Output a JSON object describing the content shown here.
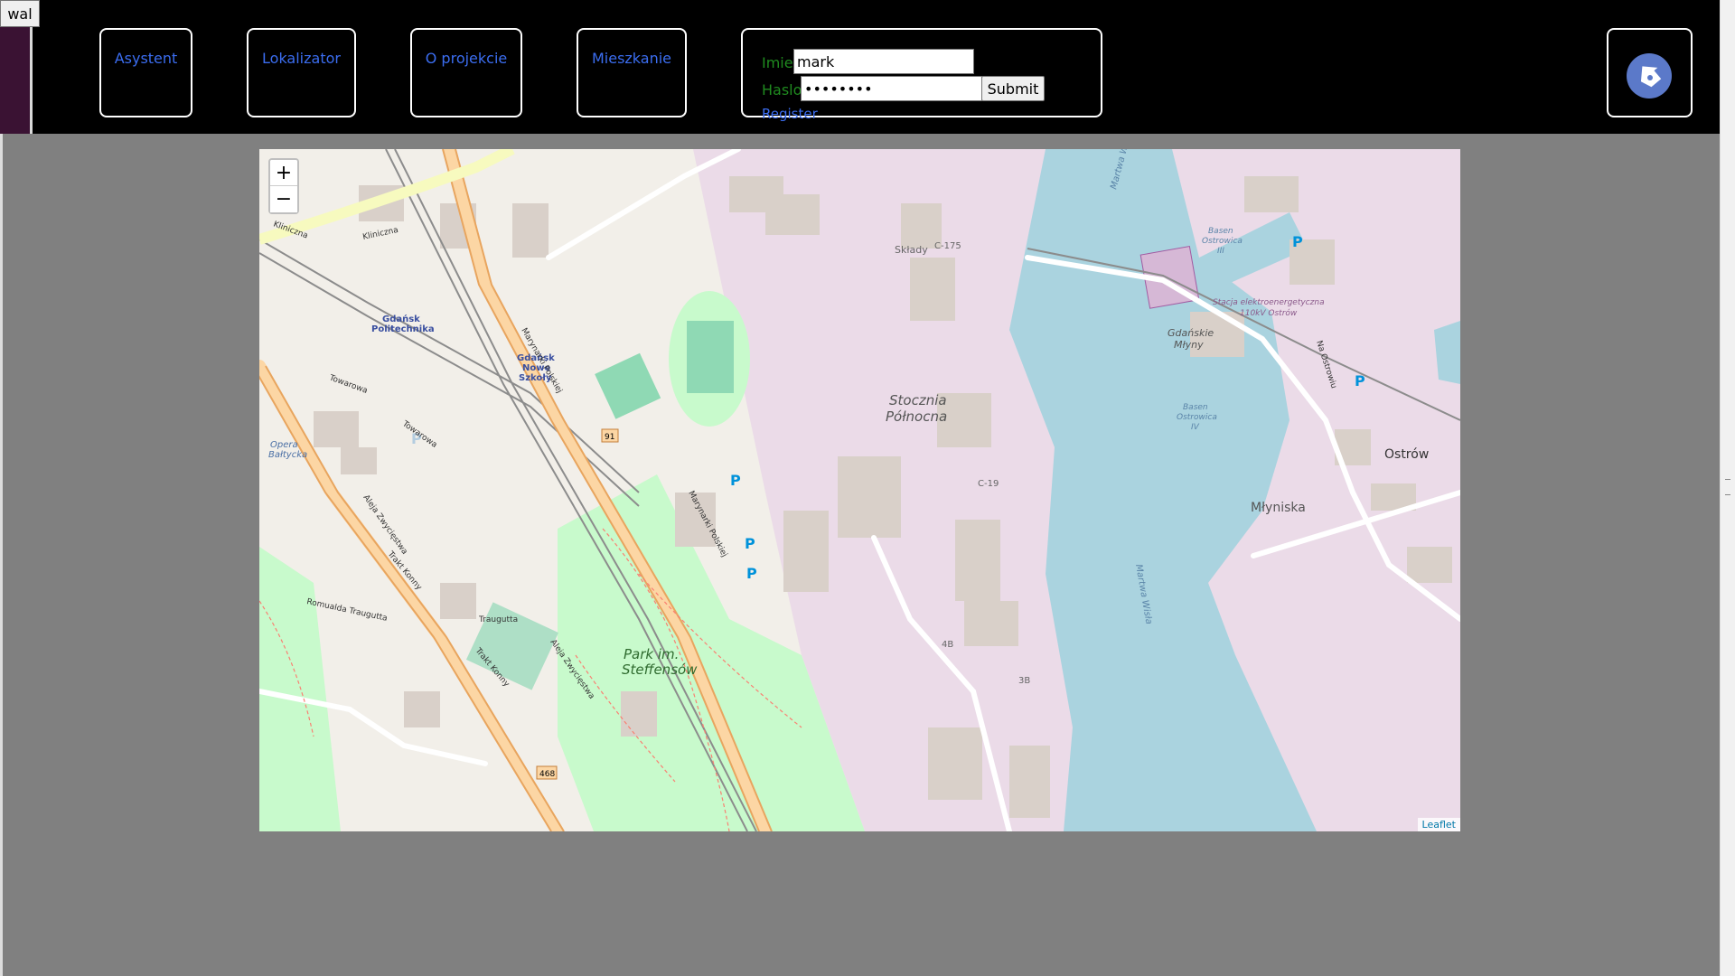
{
  "top_button": {
    "label": "wal"
  },
  "nav": {
    "items": [
      {
        "label": "Asystent"
      },
      {
        "label": "Lokalizator"
      },
      {
        "label": "O projekcie"
      },
      {
        "label": "Mieszkanie"
      }
    ]
  },
  "login": {
    "name_label": "Imie",
    "name_value": "mark",
    "password_label": "Haslo",
    "password_value": "password",
    "submit_label": "Submit",
    "register_label": "Register"
  },
  "map": {
    "zoom_in": "+",
    "zoom_out": "−",
    "attribution": "Leaflet",
    "labels": {
      "stocznia": "Stocznia",
      "polnocna": "Północna",
      "ostrow": "Ostrów",
      "mlyniska": "Młyniska",
      "park1": "Park im.",
      "park2": "Steffensów",
      "gdansk_pol1": "Gdańsk",
      "gdansk_pol2": "Politechnika",
      "gdansk_ns1": "Gdańsk",
      "gdansk_ns2": "Nowe",
      "gdansk_ns3": "Szkoły",
      "sklady": "Składy",
      "c175": "C-175",
      "c19": "C-19",
      "b4": "4B",
      "b3": "3B",
      "gdanskie1": "Gdańskie",
      "gdanskie2": "Młyny",
      "route91": "91",
      "route468": "468",
      "mortwa": "Martwa Wisła",
      "opera1": "Opera",
      "opera2": "Bałtycka",
      "stacja1": "Stacja elektroenergetyczna",
      "stacja2": "110kV Ostrów",
      "basen3a": "Basen",
      "basen3b": "Ostrowica",
      "basen3c": "III",
      "basen4a": "Basen",
      "basen4b": "Ostrowica",
      "basen4c": "IV",
      "marynarki": "Marynarki Polskiej",
      "aleja": "Aleja Zwycięstwa",
      "kliniczna": "Kliniczna",
      "towarowa": "Towarowa",
      "trakt": "Trakt Konny",
      "traugutta": "Traugutta",
      "romualda": "Romualda Traugutta",
      "nabrzeze": "Na Ostrowiu",
      "parking": "P"
    }
  },
  "colors": {
    "nav_link": "#3b6df0",
    "label_green": "#1f8a1f",
    "header_bg": "#000000",
    "page_bg": "#808080",
    "water": "#aad3df",
    "industrial": "#ebdbe8",
    "park": "#c8facc"
  }
}
